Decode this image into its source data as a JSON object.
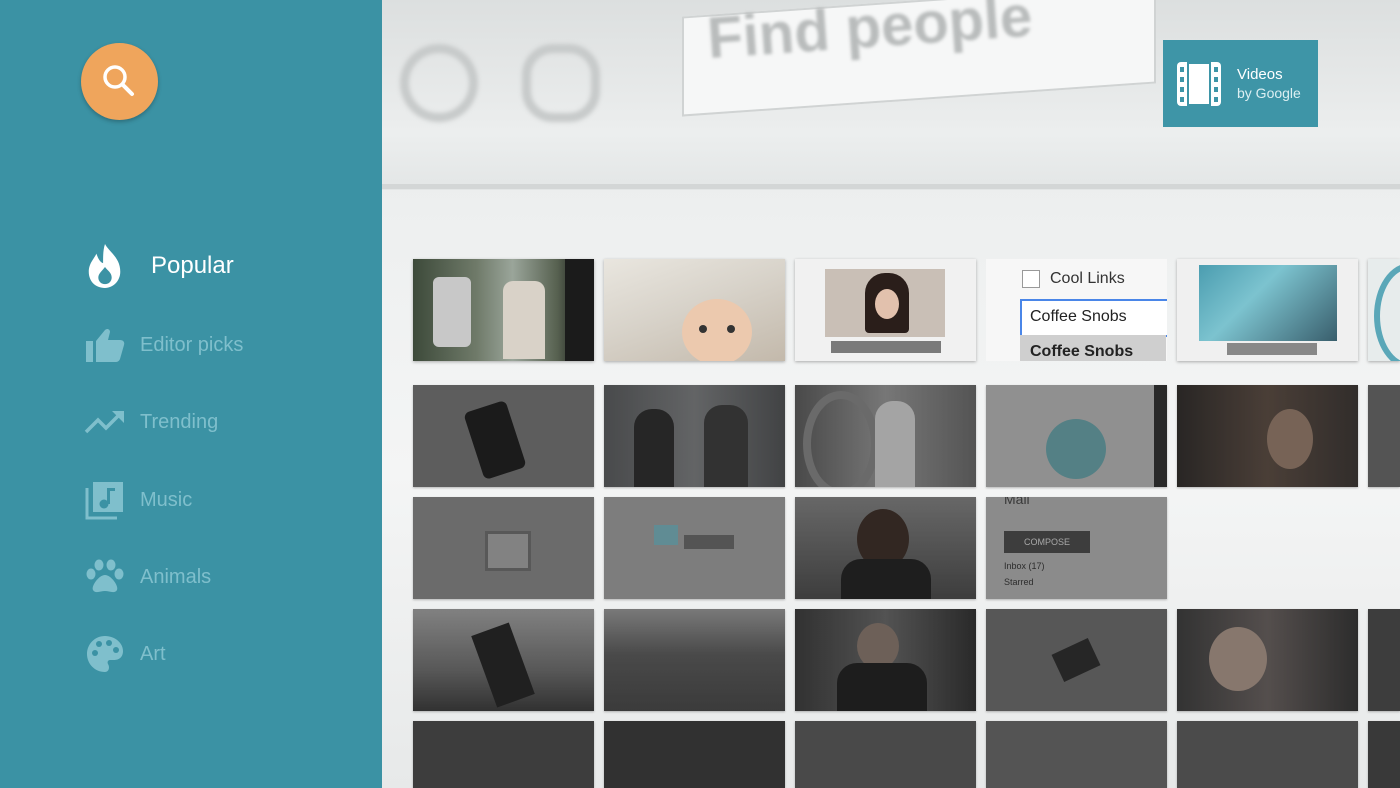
{
  "background": {
    "search_text": "Find people"
  },
  "sidebar": {
    "search_button_label": "Search",
    "items": [
      {
        "label": "Popular",
        "icon": "flame-icon",
        "active": true
      },
      {
        "label": "Editor picks",
        "icon": "thumbs-up-icon",
        "active": false
      },
      {
        "label": "Trending",
        "icon": "trending-up-icon",
        "active": false
      },
      {
        "label": "Music",
        "icon": "music-library-icon",
        "active": false
      },
      {
        "label": "Animals",
        "icon": "paw-icon",
        "active": false
      },
      {
        "label": "Art",
        "icon": "palette-icon",
        "active": false
      }
    ]
  },
  "logo": {
    "title": "Videos",
    "subtitle": "by Google"
  },
  "thumbnails": {
    "cool_links": "Cool Links",
    "coffee_input": "Coffee Snobs",
    "coffee_label": "Coffee Snobs",
    "mail_label": "Mail",
    "compose_label": "COMPOSE",
    "inbox_label": "Inbox (17)",
    "starred_label": "Starred"
  },
  "colors": {
    "sidebar": "#3b92a4",
    "search_button": "#efa55c",
    "logo_bg": "#3e95a7",
    "inactive_label": "#7fbfcc"
  }
}
